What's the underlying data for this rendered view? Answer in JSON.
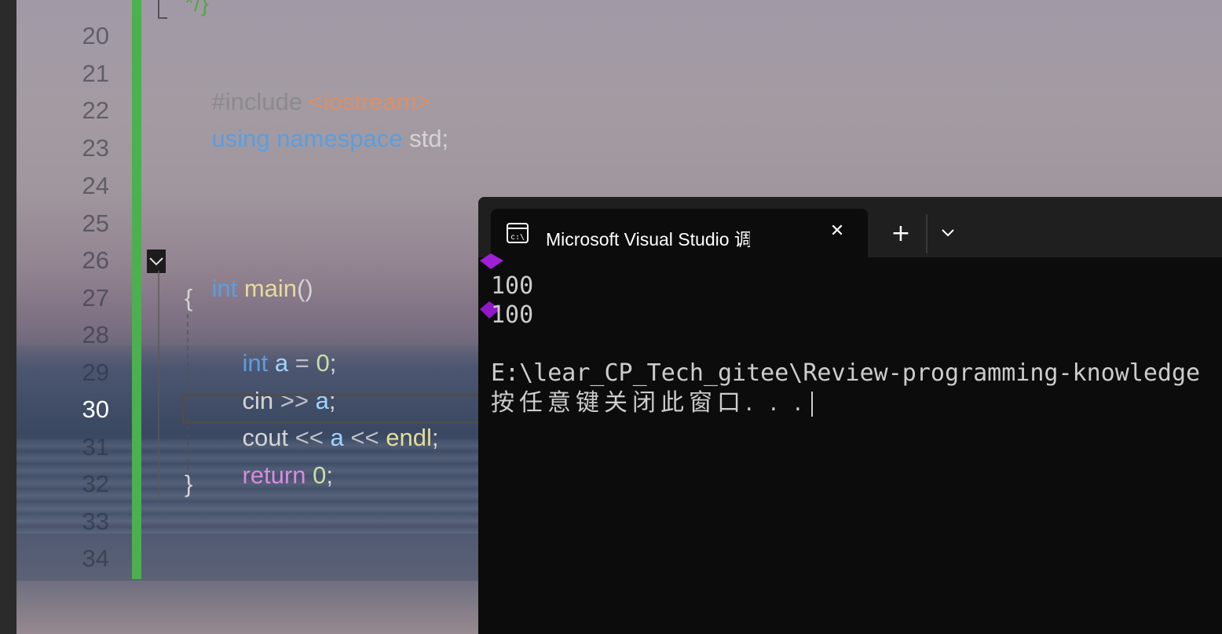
{
  "editor": {
    "line_numbers": [
      "20",
      "21",
      "22",
      "23",
      "24",
      "25",
      "26",
      "27",
      "28",
      "29",
      "30",
      "31",
      "32",
      "33",
      "34"
    ],
    "active_line": "30",
    "top_fragment": "*/}",
    "line21": {
      "pp": "#include",
      "lt": "<",
      "header": "iostream",
      "gt": ">"
    },
    "line22": {
      "kw1": "using",
      "kw2": "namespace",
      "rest": "std;"
    },
    "line26": {
      "kw": "int",
      "fn": "main",
      "paren": "()"
    },
    "line27": {
      "brace": "{"
    },
    "line28": {
      "kw": "int",
      "var": "a",
      "op": "=",
      "num": "0",
      "semi": ";"
    },
    "line29": {
      "id": "cin",
      "op": ">>",
      "var": "a",
      "semi": ";"
    },
    "line30": {
      "id": "cout",
      "op1": "<<",
      "var": "a",
      "op2": "<<",
      "fn": "endl",
      "semi": ";"
    },
    "line31": {
      "kw": "return",
      "num": "0",
      "semi": ";"
    },
    "line32": {
      "brace": "}"
    }
  },
  "terminal": {
    "tab_title": "Microsoft Visual Studio 调试控制台",
    "new_tab": "+",
    "dropdown": "⌄",
    "close": "✕",
    "output": [
      "100",
      "100",
      "",
      "E:\\lear_CP_Tech_gitee\\Review-programming-knowledge",
      "按任意键关闭此窗口. . ."
    ]
  }
}
